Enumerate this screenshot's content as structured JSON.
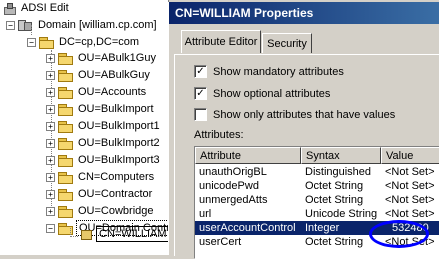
{
  "tree": {
    "root": "ADSI Edit",
    "domain": "Domain [william.cp.com]",
    "dc": "DC=cp,DC=com",
    "expand_plus": "+",
    "expand_minus": "−",
    "ous": [
      "OU=ABulk1Guy",
      "OU=ABulkGuy",
      "OU=Accounts",
      "OU=BulkImport",
      "OU=BulkImport1",
      "OU=BulkImport2",
      "OU=BulkImport3",
      "CN=Computers",
      "OU=Contractor",
      "OU=Cowbridge",
      "OU=Domain Contr"
    ],
    "selected": "CN=WILLIAM"
  },
  "window": {
    "title": "CN=WILLIAM Properties",
    "tabs": [
      "Attribute Editor",
      "Security"
    ],
    "checkboxes": [
      {
        "label": "Show mandatory attributes",
        "checked": true,
        "mark": "✓"
      },
      {
        "label": "Show optional attributes",
        "checked": true,
        "mark": "✓"
      },
      {
        "label": "Show only attributes that have values",
        "checked": false,
        "mark": ""
      }
    ],
    "attributes_label": "Attributes:",
    "columns": [
      "Attribute",
      "Syntax",
      "Value"
    ],
    "rows": [
      {
        "attr": "unauthOrigBL",
        "syntax": "Distinguished",
        "value": "<Not Set>"
      },
      {
        "attr": "unicodePwd",
        "syntax": "Octet String",
        "value": "<Not Set>"
      },
      {
        "attr": "unmergedAtts",
        "syntax": "Octet String",
        "value": "<Not Set>"
      },
      {
        "attr": "url",
        "syntax": "Unicode String",
        "value": "<Not Set>"
      },
      {
        "attr": "userAccountControl",
        "syntax": "Integer",
        "value": "532480"
      },
      {
        "attr": "userCert",
        "syntax": "Octet String",
        "value": "<Not Set>"
      }
    ],
    "highlight_color": "#0000ff",
    "selection_color": "#0a246a"
  }
}
